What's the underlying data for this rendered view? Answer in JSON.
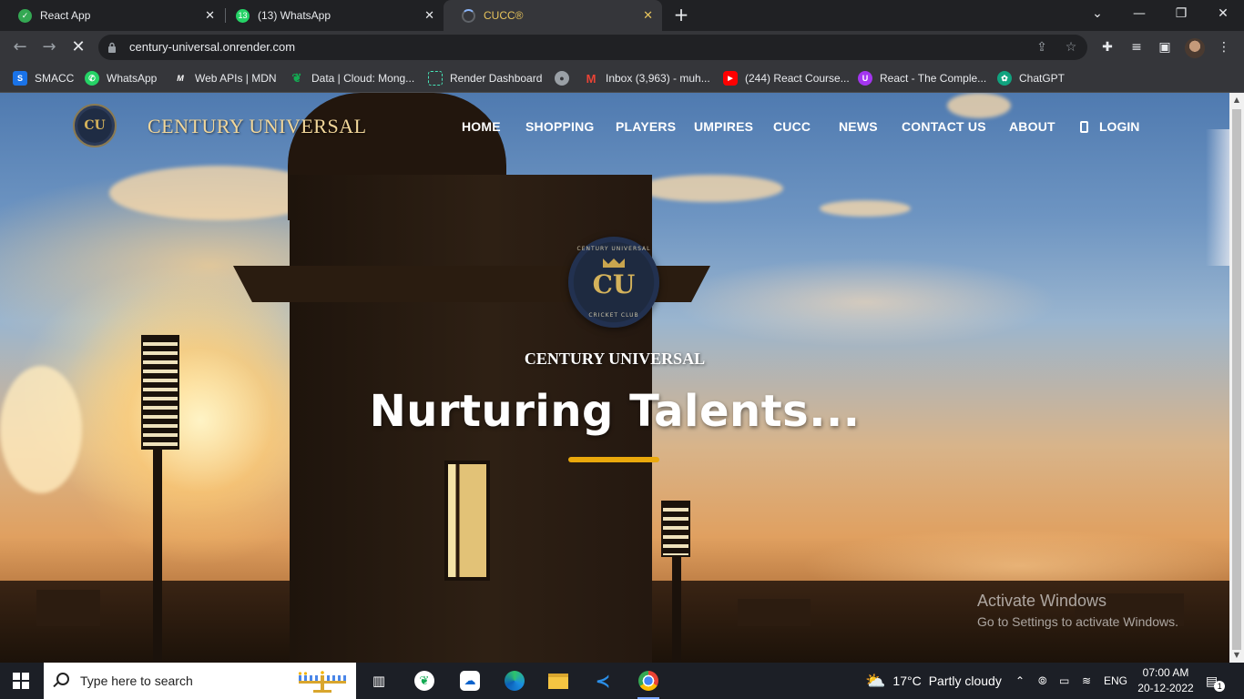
{
  "browser": {
    "tabs": [
      {
        "title": "React App",
        "favicon": "check-circle-icon",
        "active": false
      },
      {
        "title": "(13) WhatsApp",
        "favicon": "whatsapp-icon",
        "badge": "13",
        "active": false
      },
      {
        "title": "CUCC®",
        "favicon": "loading-spinner-icon",
        "active": true
      }
    ],
    "url": "century-universal.onrender.com",
    "bookmarks": [
      {
        "label": "SMACC",
        "icon": "smacc-icon",
        "color": "#1a73e8"
      },
      {
        "label": "WhatsApp",
        "icon": "whatsapp-icon",
        "color": "#25d366"
      },
      {
        "label": "Web APIs | MDN",
        "icon": "mdn-icon",
        "color": "#000000"
      },
      {
        "label": "Data | Cloud: Mong...",
        "icon": "mongodb-leaf-icon",
        "color": "#13aa52"
      },
      {
        "label": "Render Dashboard",
        "icon": "render-icon",
        "color": "#46e3b7"
      },
      {
        "label": "",
        "icon": "globe-icon",
        "color": "#9aa0a6"
      },
      {
        "label": "Inbox (3,963) - muh...",
        "icon": "gmail-icon",
        "color": "#ea4335"
      },
      {
        "label": "(244) React Course...",
        "icon": "youtube-icon",
        "color": "#ff0000"
      },
      {
        "label": "React - The Comple...",
        "icon": "udemy-icon",
        "color": "#a435f0"
      },
      {
        "label": "ChatGPT",
        "icon": "chatgpt-icon",
        "color": "#10a37f"
      }
    ]
  },
  "site": {
    "brand": "CENTURY UNIVERSAL",
    "brand_monogram": "CU",
    "nav": [
      "HOME",
      "SHOPPING",
      "PLAYERS",
      "UMPIRES",
      "CUCC",
      "NEWS",
      "CONTACT US",
      "ABOUT"
    ],
    "login_label": "LOGIN",
    "hero": {
      "logo_ring_top": "CENTURY UNIVERSAL",
      "logo_monogram": "CU",
      "logo_ring_bottom": "CRICKET CLUB",
      "name": "CENTURY UNIVERSAL",
      "tagline": "Nurturing Talents...",
      "accent": "#e9a80c"
    }
  },
  "watermark": {
    "line1": "Activate Windows",
    "line2": "Go to Settings to activate Windows."
  },
  "taskbar": {
    "search_placeholder": "Type here to search",
    "apps": [
      "task-view-icon",
      "mongodb-compass-icon",
      "onedrive-icon",
      "edge-icon",
      "file-explorer-icon",
      "vscode-icon",
      "chrome-icon"
    ],
    "weather_temp": "17°C",
    "weather_desc": "Partly cloudy",
    "language": "ENG",
    "time": "07:00 AM",
    "date": "20-12-2022",
    "notification_count": "1"
  }
}
